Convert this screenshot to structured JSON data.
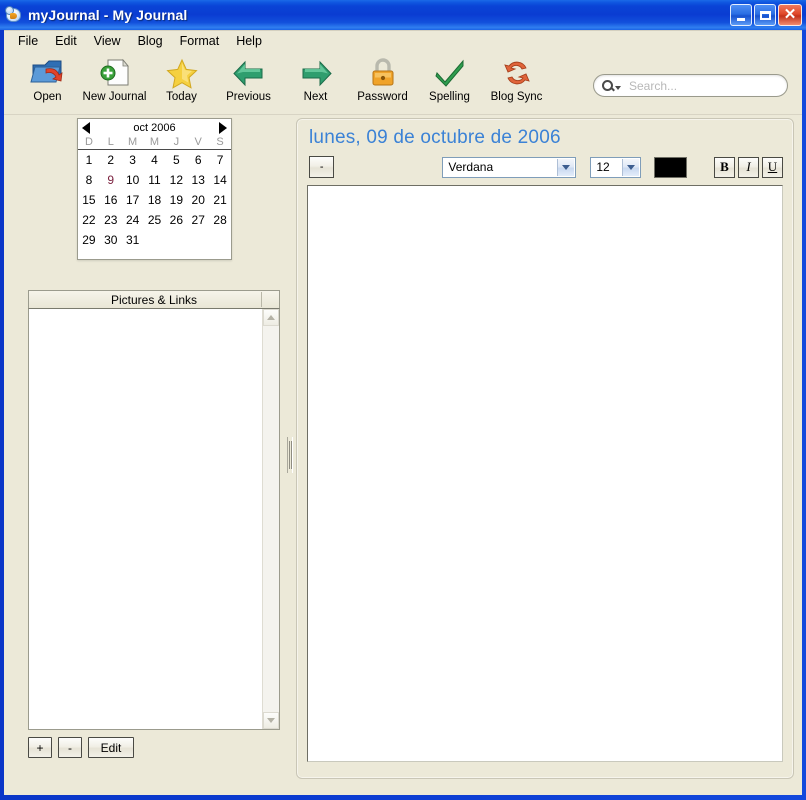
{
  "window": {
    "title": "myJournal - My Journal",
    "app_icon": "journal-bird-icon",
    "minimize_label": "Minimize",
    "maximize_label": "Maximize",
    "close_label": "Close"
  },
  "menubar": {
    "items": [
      {
        "label": "File"
      },
      {
        "label": "Edit"
      },
      {
        "label": "View"
      },
      {
        "label": "Blog"
      },
      {
        "label": "Format"
      },
      {
        "label": "Help"
      }
    ]
  },
  "toolbar": {
    "buttons": [
      {
        "label": "Open",
        "icon": "open-folder-icon"
      },
      {
        "label": "New Journal",
        "icon": "new-document-icon"
      },
      {
        "label": "Today",
        "icon": "star-icon"
      },
      {
        "label": "Previous",
        "icon": "arrow-left-icon"
      },
      {
        "label": "Next",
        "icon": "arrow-right-icon"
      },
      {
        "label": "Password",
        "icon": "padlock-icon"
      },
      {
        "label": "Spelling",
        "icon": "checkmark-icon"
      },
      {
        "label": "Blog Sync",
        "icon": "sync-refresh-icon"
      }
    ]
  },
  "search": {
    "placeholder": "Search...",
    "value": "",
    "icon": "search-magnifier-icon"
  },
  "calendar": {
    "title": "oct 2006",
    "prev_label": "Previous month",
    "next_label": "Next month",
    "day_headers": [
      "D",
      "L",
      "M",
      "M",
      "J",
      "V",
      "S"
    ],
    "leading_blanks": 0,
    "days": [
      1,
      2,
      3,
      4,
      5,
      6,
      7,
      8,
      9,
      10,
      11,
      12,
      13,
      14,
      15,
      16,
      17,
      18,
      19,
      20,
      21,
      22,
      23,
      24,
      25,
      26,
      27,
      28,
      29,
      30,
      31
    ],
    "selected_day": 9,
    "selected_bubble_color": "#3a3fd8",
    "selected_text_color": "#7a1f3d"
  },
  "pictures_panel": {
    "header": "Pictures & Links",
    "items": [],
    "buttons": [
      {
        "label": "+",
        "name": "add-picture-button"
      },
      {
        "label": "-",
        "name": "remove-picture-button"
      },
      {
        "label": "Edit",
        "name": "edit-picture-button"
      }
    ]
  },
  "editor": {
    "date_heading": "lunes, 09 de octubre de 2006",
    "heading_color": "#3b82d6",
    "dash_button_label": "-",
    "font_family": "Verdana",
    "font_size": "12",
    "text_color": "#000000",
    "bold_label": "B",
    "italic_label": "I",
    "underline_label": "U",
    "content": ""
  }
}
